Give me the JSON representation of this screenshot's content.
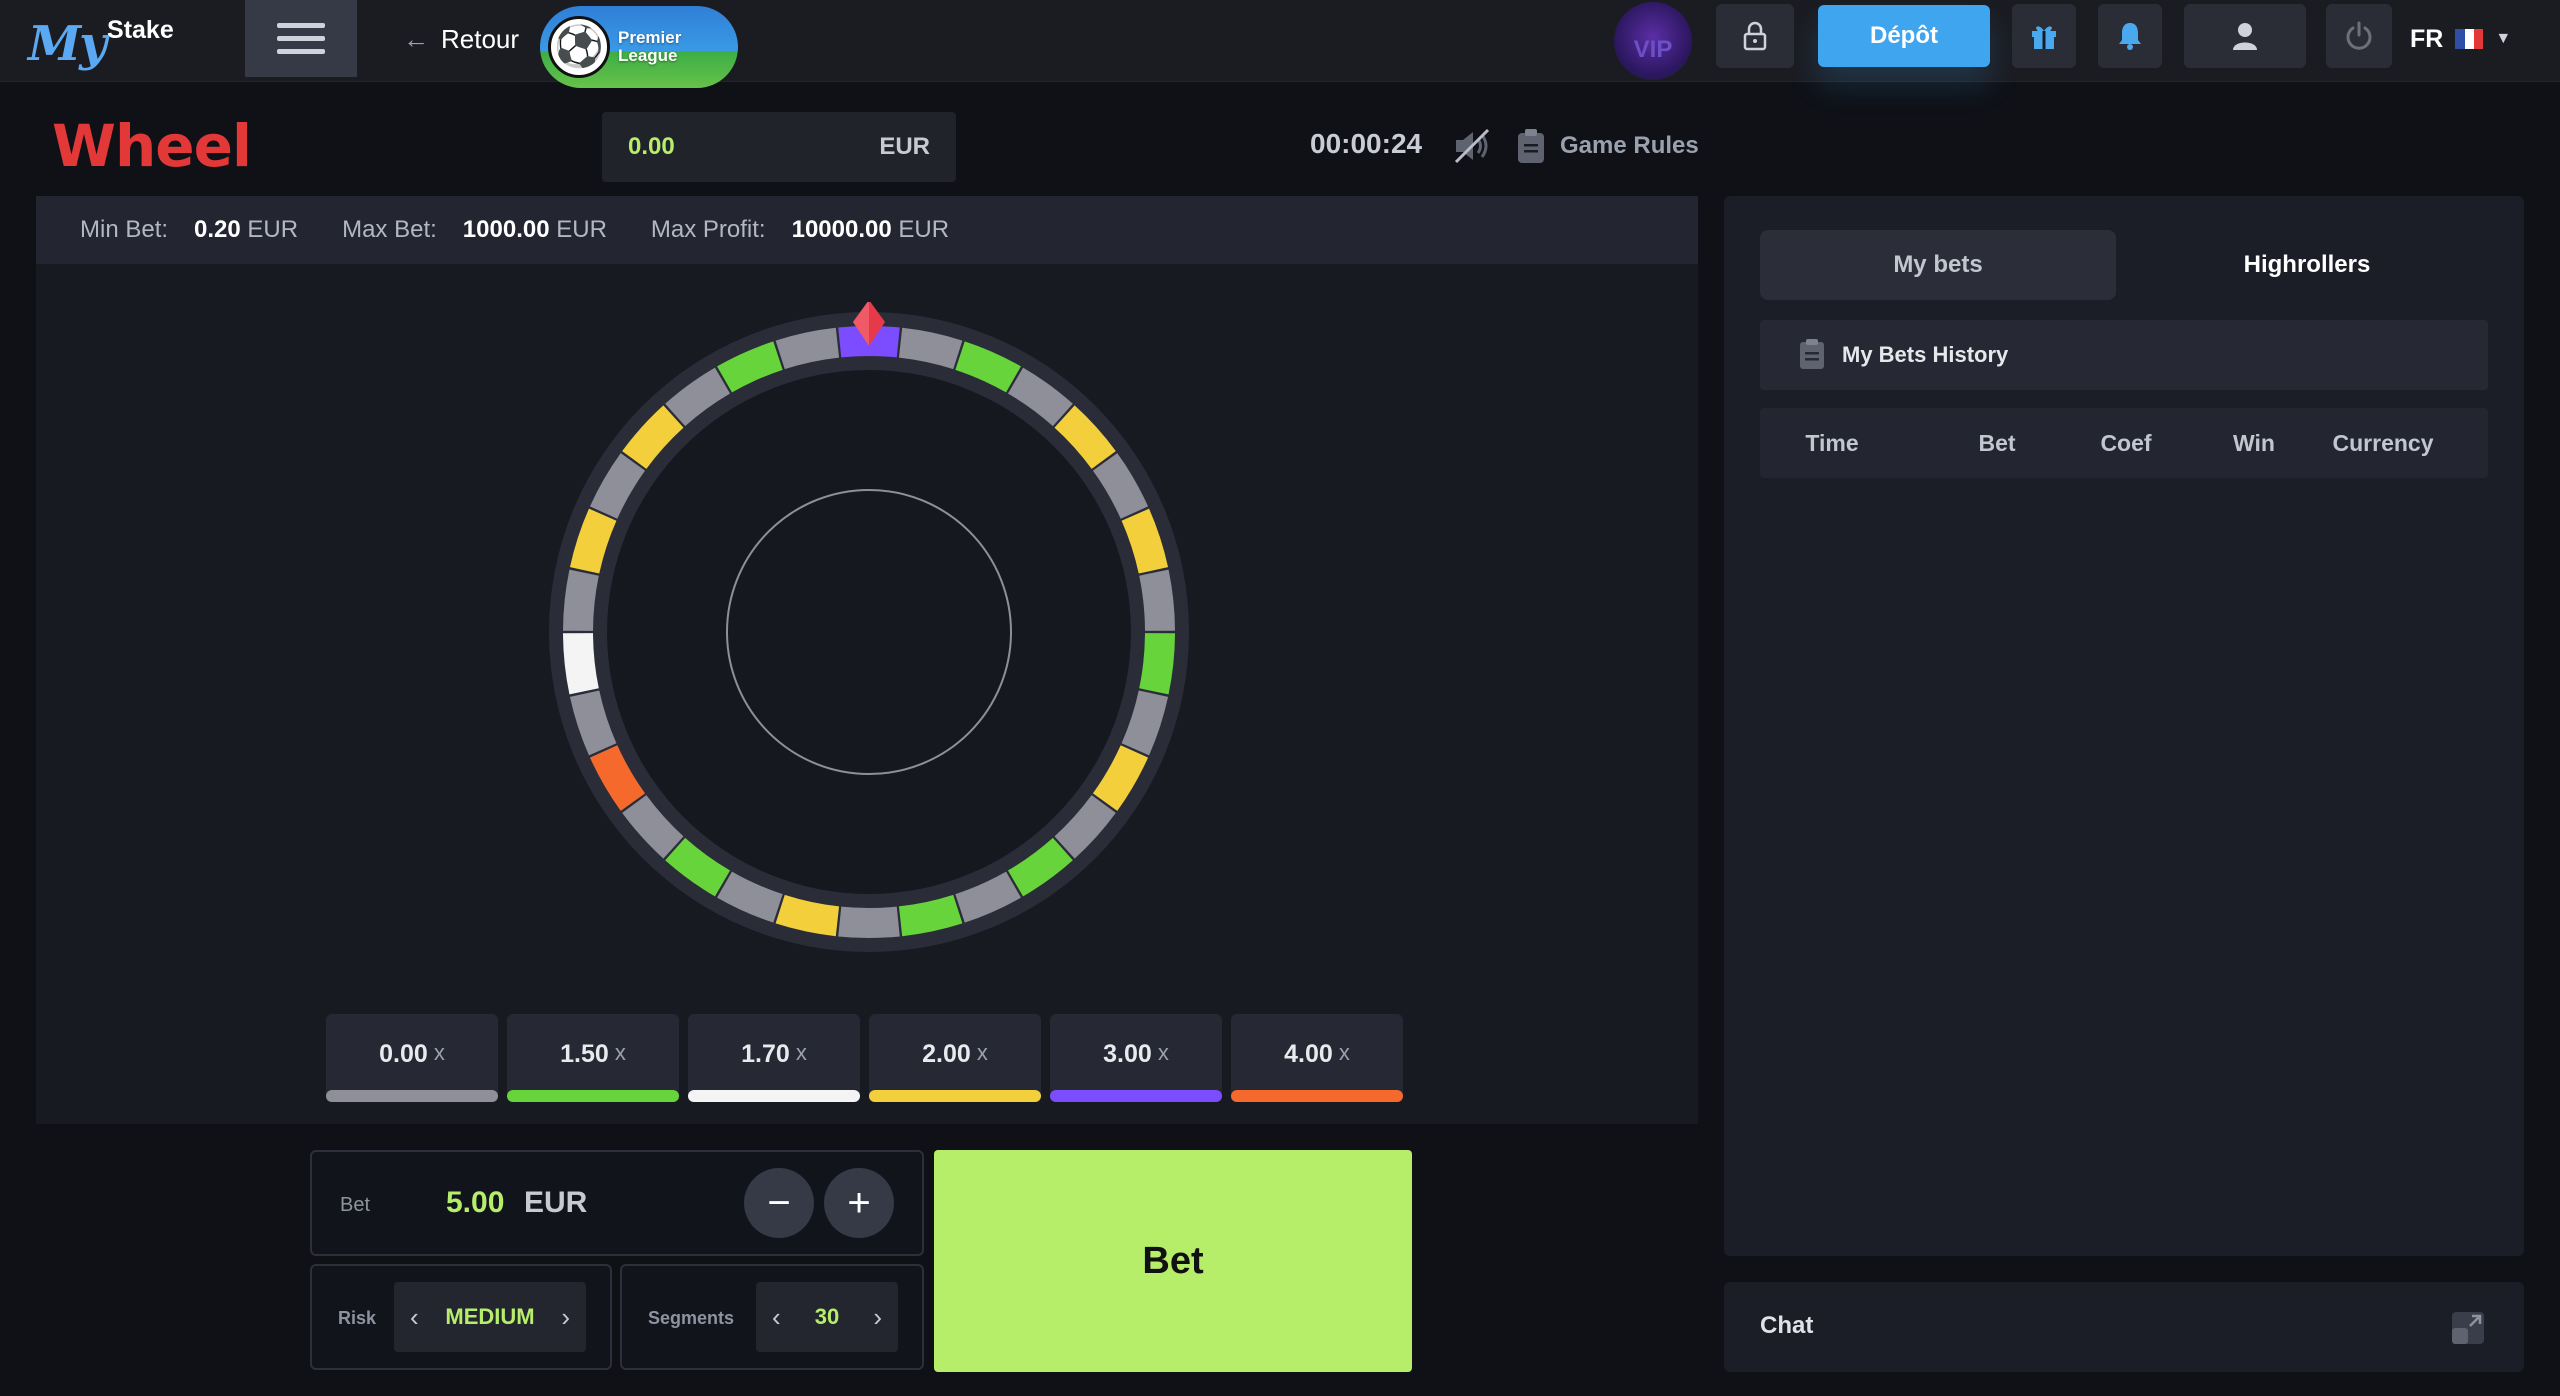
{
  "header": {
    "logo_my": "My",
    "logo_stake": "Stake",
    "back_label": "Retour",
    "promo_text_line1": "Premier",
    "promo_text_line2": "League",
    "vip_label": "VIP",
    "deposit_label": "Dépôt",
    "language": "FR"
  },
  "game": {
    "title": "Wheel",
    "balance_amount": "0.00",
    "balance_currency": "EUR",
    "timer": "00:00:24",
    "rules_label": "Game Rules"
  },
  "limits": {
    "min_label": "Min Bet:",
    "min_value": "0.20",
    "min_currency": "EUR",
    "max_label": "Max Bet:",
    "max_value": "1000.00",
    "max_currency": "EUR",
    "profit_label": "Max Profit:",
    "profit_value": "10000.00",
    "profit_currency": "EUR"
  },
  "wheel": {
    "segment_count": 30,
    "segment_colors": [
      "#8e8f98",
      "#8e8f98",
      "#68d43c",
      "#8e8f98",
      "#f2cf3b",
      "#8e8f98",
      "#f2cf3b",
      "#8e8f98",
      "#68d43c",
      "#8e8f98",
      "#f2cf3b",
      "#8e8f98",
      "#68d43c",
      "#8e8f98",
      "#68d43c",
      "#8e8f98",
      "#f2cf3b",
      "#8e8f98",
      "#68d43c",
      "#8e8f98",
      "#f56a2c",
      "#8e8f98",
      "#f4f4f4",
      "#8e8f98",
      "#f2cf3b",
      "#8e8f98",
      "#f2cf3b",
      "#8e8f98",
      "#68d43c",
      "#8e8f98"
    ],
    "pointer_segment_color": "#7c4dff"
  },
  "multipliers": [
    {
      "value": "0.00",
      "suffix": "x",
      "color": "#8e8f98"
    },
    {
      "value": "1.50",
      "suffix": "x",
      "color": "#68d43c"
    },
    {
      "value": "1.70",
      "suffix": "x",
      "color": "#f4f4f4"
    },
    {
      "value": "2.00",
      "suffix": "x",
      "color": "#f2cf3b"
    },
    {
      "value": "3.00",
      "suffix": "x",
      "color": "#7c4dff"
    },
    {
      "value": "4.00",
      "suffix": "x",
      "color": "#f56a2c"
    }
  ],
  "controls": {
    "bet_label": "Bet",
    "bet_amount": "5.00",
    "bet_currency": "EUR",
    "minus_symbol": "−",
    "plus_symbol": "+",
    "risk_label": "Risk",
    "risk_value": "MEDIUM",
    "segments_label": "Segments",
    "segments_value": "30",
    "bet_button": "Bet",
    "prev_symbol": "‹",
    "next_symbol": "›"
  },
  "side_panel": {
    "tabs": [
      {
        "label": "My bets",
        "active": false
      },
      {
        "label": "Highrollers",
        "active": true
      }
    ],
    "history_title": "My Bets History",
    "columns": [
      "Time",
      "Bet",
      "Coef",
      "Win",
      "Currency"
    ],
    "chat_label": "Chat"
  }
}
